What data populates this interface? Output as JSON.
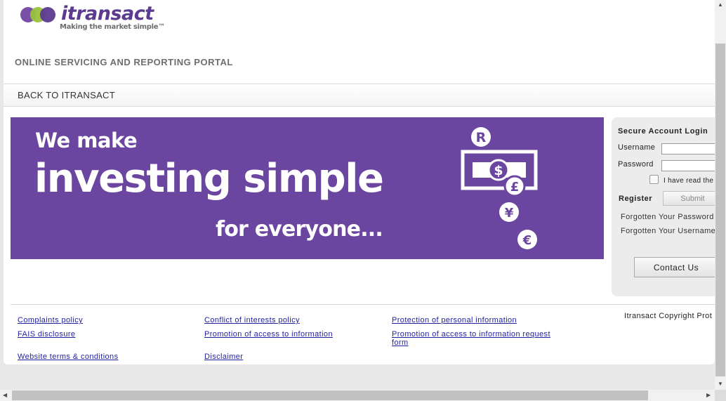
{
  "header": {
    "logo": {
      "wordmark": "itransact",
      "tagline": "Making the market simple™"
    },
    "portal_title": "ONLINE SERVICING AND REPORTING PORTAL"
  },
  "nav": {
    "back_link": "BACK TO ITRANSACT"
  },
  "banner": {
    "line1": "We make",
    "line2": "investing simple",
    "line3": "for everyone...",
    "currency_icons": [
      "rand-icon",
      "dollar-icon",
      "pound-icon",
      "yen-icon",
      "euro-icon"
    ],
    "colors": {
      "background": "#6b46a0",
      "text": "#ffffff"
    }
  },
  "login": {
    "title": "Secure Account Login",
    "username_label": "Username",
    "username_value": "",
    "password_label": "Password",
    "password_value": "",
    "terms_text": "I have read the",
    "terms_checked": false,
    "register_label": "Register",
    "submit_label": "Submit",
    "forgot_password": "Forgotten Your Password",
    "forgot_username": "Forgotten Your Username",
    "contact_label": "Contact Us"
  },
  "footer": {
    "links": {
      "complaints": "Complaints policy",
      "conflict": "Conflict of interests policy",
      "protection": "Protection of personal information",
      "fais": "FAIS disclosure",
      "promotion": "Promotion of access to information",
      "promotion_request": "Promotion of access to information request form",
      "terms": "Website terms & conditions",
      "disclaimer": "Disclaimer"
    },
    "copyright": "Itransact Copyright Prot"
  },
  "colors": {
    "brand_purple": "#5b3a8f",
    "link_blue": "#1f1f9f",
    "page_bg": "#e8e8e8"
  }
}
